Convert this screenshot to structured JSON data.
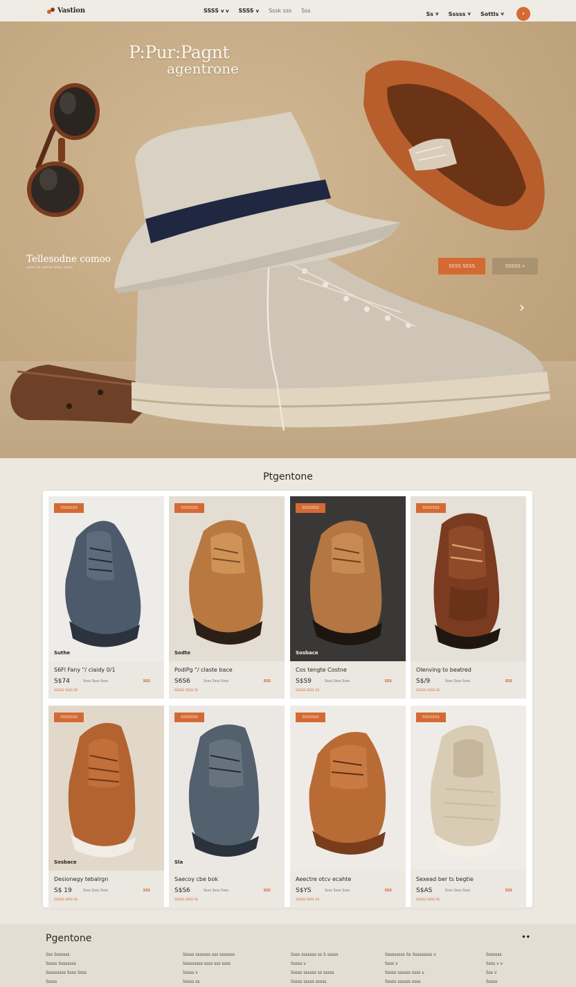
{
  "nav": {
    "brand": "Vastion",
    "links": [
      {
        "label": "SSSS",
        "chevron": "v v"
      },
      {
        "label": "SSSS",
        "chevron": "v"
      },
      {
        "label": "Sssk sss",
        "chevron": ""
      },
      {
        "label": "Sss",
        "chevron": ""
      }
    ],
    "right_links": [
      {
        "label": "Ss",
        "chevron": "v"
      },
      {
        "label": "Sssss",
        "chevron": "v"
      },
      {
        "label": "Sottls",
        "chevron": "v"
      }
    ],
    "cta_icon": "›"
  },
  "hero": {
    "title_line1": "P:Pur:Pagnt",
    "title_line2": "agentrone",
    "tagline": "Tellesodne comoo",
    "tagline_sub": "ssss ss sssss ssss ssss",
    "primary_button": "SSSS SSSS",
    "secondary_button": "SSSSS »",
    "next_icon": "›",
    "colors": {
      "accent": "#d46a33",
      "background": "#c6ab85"
    }
  },
  "products": {
    "section_title": "Ptgentone",
    "items": [
      {
        "badge": "SSSSSSS",
        "caption": "Suthe",
        "name": "S6Fl Fany \"/ claidy 0/1",
        "price": "S$74",
        "meta": "Ssss Ssss Ssss",
        "rating": "SSS",
        "ship": "SSSSS SSSS SS"
      },
      {
        "badge": "SSSSSSS",
        "caption": "Sodte",
        "name": "PodiPg \"/ claste bace",
        "price": "S6S6",
        "meta": "Ssss Ssss Ssss",
        "rating": "SSS",
        "ship": "SSSSS SSSS SS"
      },
      {
        "badge": "SSSSSSS",
        "caption": "Sosbace",
        "name": "Cos tengte Costne",
        "price": "S$S9",
        "meta": "Ssss Ssss Ssss",
        "rating": "SSS",
        "ship": "SSSSS SSSS SS"
      },
      {
        "badge": "SSSSSSS",
        "caption": "",
        "name": "Olenving to beatred",
        "price": "S$/9",
        "meta": "Ssss Ssss Ssss",
        "rating": "SSS",
        "ship": "SSSSS SSSS SS"
      },
      {
        "badge": "SSSSSSS",
        "caption": "Sosbace",
        "name": "Desionegy tebalrgn",
        "price": "S$ 19",
        "meta": "Ssss Ssss Ssss",
        "rating": "SSS",
        "ship": "SSSSS SSSS SS"
      },
      {
        "badge": "SSSSSSS",
        "caption": "Sla",
        "name": "Saecoy cbe bok",
        "price": "S$S6",
        "meta": "Ssss Ssss Ssss",
        "rating": "SSS",
        "ship": "SSSSS SSSS SS"
      },
      {
        "badge": "SSSSSSS",
        "caption": "",
        "name": "Aeectre otcv ecahte",
        "price": "S$YS",
        "meta": "Ssss Ssss Ssss",
        "rating": "SSS",
        "ship": "SSSSS SSSS SS"
      },
      {
        "badge": "SSSSSSS",
        "caption": "",
        "name": "Sexead ber ts begtie",
        "price": "S$AS",
        "meta": "Ssss Ssss Ssss",
        "rating": "SSS",
        "ship": "SSSSS SSSS SS"
      }
    ]
  },
  "footer": {
    "brand": "Pgentone",
    "more": "••",
    "columns": [
      [
        "Sss Sssssss",
        "Sssss Ssssssss",
        "Sssssssss Ssss Ssss",
        "Sssss"
      ],
      [
        "Sssss sssssss sss sssssss",
        "Sssssssss ssss sss ssss",
        "Sssss v",
        "Sssss ss"
      ],
      [
        "Ssss sssssss ss S sssss",
        "Sssss v",
        "Sssss ssssss ss sssss",
        "Sssss sssss sssss"
      ],
      [
        "Sssssssss Ss Sssssssss v",
        "Ssss v",
        "Sssss ssssss ssss v",
        "Sssss ssssss ssss"
      ],
      [
        "Sssssss",
        "Ssss v v",
        "Sss v",
        "Sssss"
      ]
    ]
  }
}
